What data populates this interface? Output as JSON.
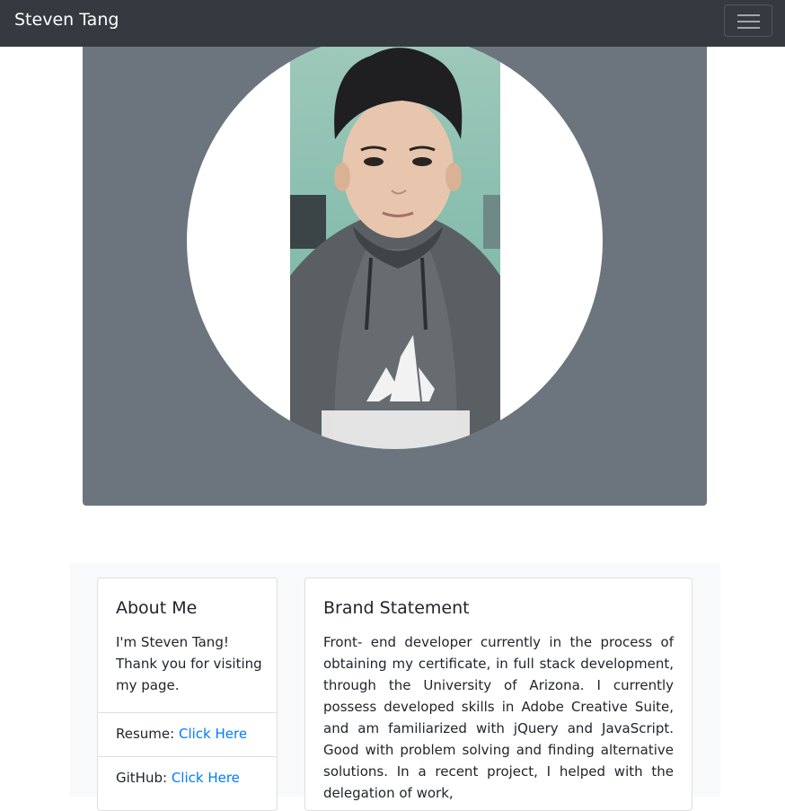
{
  "navbar": {
    "brand": "Steven Tang",
    "toggler_icon": "hamburger-menu-icon"
  },
  "profile_photo": {
    "shape": "circle",
    "subject": "portrait-photo"
  },
  "about": {
    "title": "About Me",
    "text": "I'm Steven Tang! Thank you for visiting my page.",
    "resume_label": "Resume:",
    "resume_link": "Click Here",
    "github_label": "GitHub:",
    "github_link": "Click Here"
  },
  "brand_statement": {
    "title": "Brand Statement",
    "text": "Front- end developer currently in the process of obtaining my certificate, in full stack development, through the University of Arizona. I currently possess developed skills in Adobe Creative Suite, and am familiarized with jQuery and JavaScript. Good with problem solving and finding alternative solutions. In a recent project, I helped with the delegation of work,"
  },
  "colors": {
    "navbar_bg": "#343a40",
    "jumbotron_bg": "#6c757d",
    "section_bg": "#f8f9fa",
    "link": "#007bff"
  }
}
